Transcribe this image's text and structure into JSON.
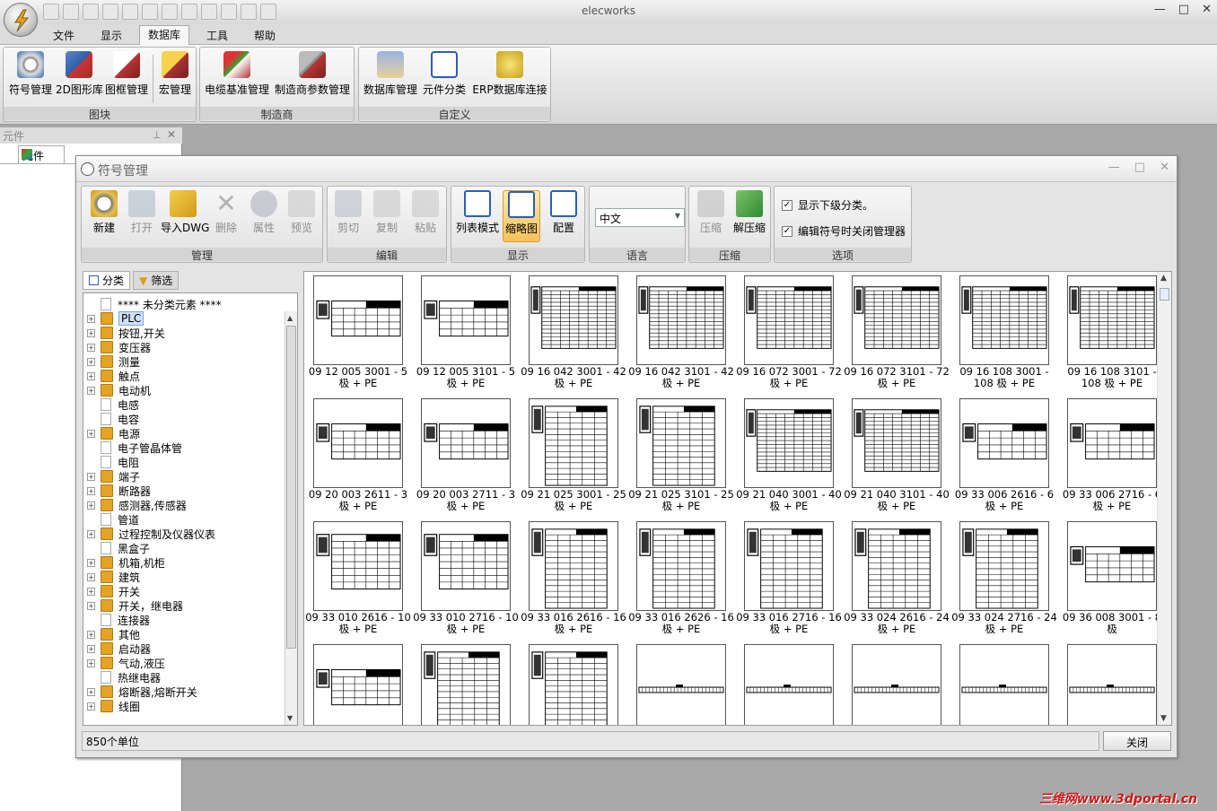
{
  "app": {
    "title": "elecworks"
  },
  "menu_tabs": [
    {
      "label": "文件"
    },
    {
      "label": "显示"
    },
    {
      "label": "数据库"
    },
    {
      "label": "工具"
    },
    {
      "label": "帮助"
    }
  ],
  "ribbon": {
    "groups": [
      {
        "label": "图块",
        "buttons": [
          "符号管理",
          "2D图形库",
          "图框管理",
          "宏管理"
        ]
      },
      {
        "label": "制造商",
        "buttons": [
          "电缆基准管理",
          "制造商参数管理"
        ]
      },
      {
        "label": "自定义",
        "buttons": [
          "数据库管理",
          "元件分类",
          "ERP数据库连接"
        ]
      }
    ]
  },
  "left_panel": {
    "header": "元件",
    "tab": "元件"
  },
  "dialog": {
    "title": "符号管理",
    "groups": {
      "manage": {
        "label": "管理",
        "buttons": [
          "新建",
          "打开",
          "导入DWG",
          "删除",
          "属性",
          "预览"
        ]
      },
      "edit": {
        "label": "编辑",
        "buttons": [
          "剪切",
          "复制",
          "粘贴"
        ]
      },
      "display": {
        "label": "显示",
        "buttons": [
          "列表模式",
          "缩略图",
          "配置"
        ]
      },
      "language": {
        "label": "语言",
        "selected": "中文"
      },
      "compress": {
        "label": "压缩",
        "buttons": [
          "压缩",
          "解压缩"
        ]
      },
      "options": {
        "label": "选项",
        "checkboxes": [
          {
            "label": "显示下级分类。",
            "checked": true
          },
          {
            "label": "编辑符号时关闭管理器",
            "checked": true
          }
        ]
      }
    },
    "tree_tabs": [
      "分类",
      "筛选"
    ],
    "tree": [
      {
        "label": "**** 未分类元素 ****",
        "expandable": false,
        "folder": false
      },
      {
        "label": "PLC",
        "expandable": true,
        "folder": true,
        "selected": true
      },
      {
        "label": "按钮,开关",
        "expandable": true,
        "folder": true
      },
      {
        "label": "变压器",
        "expandable": true,
        "folder": true
      },
      {
        "label": "测量",
        "expandable": true,
        "folder": true
      },
      {
        "label": "触点",
        "expandable": true,
        "folder": true
      },
      {
        "label": "电动机",
        "expandable": true,
        "folder": true
      },
      {
        "label": "电感",
        "expandable": false,
        "folder": false
      },
      {
        "label": "电容",
        "expandable": false,
        "folder": false
      },
      {
        "label": "电源",
        "expandable": true,
        "folder": true
      },
      {
        "label": "电子管晶体管",
        "expandable": false,
        "folder": false
      },
      {
        "label": "电阻",
        "expandable": false,
        "folder": false
      },
      {
        "label": "端子",
        "expandable": true,
        "folder": true
      },
      {
        "label": "断路器",
        "expandable": true,
        "folder": true
      },
      {
        "label": "感测器,传感器",
        "expandable": true,
        "folder": true
      },
      {
        "label": "管道",
        "expandable": false,
        "folder": false
      },
      {
        "label": "过程控制及仪器仪表",
        "expandable": true,
        "folder": true
      },
      {
        "label": "黑盒子",
        "expandable": false,
        "folder": false
      },
      {
        "label": "机箱,机柜",
        "expandable": true,
        "folder": true
      },
      {
        "label": "建筑",
        "expandable": true,
        "folder": true
      },
      {
        "label": "开关",
        "expandable": true,
        "folder": true
      },
      {
        "label": "开关，继电器",
        "expandable": true,
        "folder": true
      },
      {
        "label": "连接器",
        "expandable": false,
        "folder": false
      },
      {
        "label": "其他",
        "expandable": true,
        "folder": true
      },
      {
        "label": "启动器",
        "expandable": true,
        "folder": true
      },
      {
        "label": "气动,液压",
        "expandable": true,
        "folder": true
      },
      {
        "label": "热继电器",
        "expandable": false,
        "folder": false
      },
      {
        "label": "熔断器,熔断开关",
        "expandable": true,
        "folder": true
      },
      {
        "label": "线圈",
        "expandable": true,
        "folder": true
      }
    ],
    "thumbnails": [
      {
        "label": "09 12 005 3001 - 5 极 + PE",
        "style": "wide"
      },
      {
        "label": "09 12 005 3101 - 5 极 + PE",
        "style": "wide"
      },
      {
        "label": "09 16 042 3001 - 42 极 + PE",
        "style": "dense"
      },
      {
        "label": "09 16 042 3101 - 42 极 + PE",
        "style": "dense"
      },
      {
        "label": "09 16 072 3001 - 72 极 + PE",
        "style": "dense"
      },
      {
        "label": "09 16 072 3101 - 72 极 + PE",
        "style": "dense"
      },
      {
        "label": "09 16 108 3001 - 108 极 + PE",
        "style": "dense"
      },
      {
        "label": "09 16 108 3101 - 108 极 + PE",
        "style": "dense"
      },
      {
        "label": "09 20 003 2611 - 3 极 + PE",
        "style": "wide"
      },
      {
        "label": "09 20 003 2711 - 3 极 + PE",
        "style": "wide"
      },
      {
        "label": "09 21 025 3001 - 25 极 + PE",
        "style": "tall"
      },
      {
        "label": "09 21 025 3101 - 25 极 + PE",
        "style": "tall"
      },
      {
        "label": "09 21 040 3001 - 40 极 + PE",
        "style": "dense"
      },
      {
        "label": "09 21 040 3101 - 40 极 + PE",
        "style": "dense"
      },
      {
        "label": "09 33 006 2616 - 6 极 + PE",
        "style": "wide"
      },
      {
        "label": "09 33 006 2716 - 6 极 + PE",
        "style": "wide"
      },
      {
        "label": "09 33 010 2616 - 10 极 + PE",
        "style": "medium"
      },
      {
        "label": "09 33 010 2716 - 10 极 + PE",
        "style": "medium"
      },
      {
        "label": "09 33 016 2616 - 16 极 + PE",
        "style": "tall"
      },
      {
        "label": "09 33 016 2626 - 16 极 + PE",
        "style": "tall"
      },
      {
        "label": "09 33 016 2716 - 16 极 + PE",
        "style": "tall"
      },
      {
        "label": "09 33 024 2616 - 24 极 + PE",
        "style": "tall"
      },
      {
        "label": "09 33 024 2716 - 24 极 + PE",
        "style": "tall"
      },
      {
        "label": "09 36 008 3001 - 8 极",
        "style": "wide"
      },
      {
        "label": "",
        "style": "wide"
      },
      {
        "label": "",
        "style": "tall"
      },
      {
        "label": "",
        "style": "tall"
      },
      {
        "label": "",
        "style": "bar"
      },
      {
        "label": "",
        "style": "bar"
      },
      {
        "label": "",
        "style": "bar"
      },
      {
        "label": "",
        "style": "bar"
      },
      {
        "label": "",
        "style": "bar"
      }
    ],
    "status": "850个单位",
    "close_label": "关闭"
  },
  "watermark": "三维网www.3dportal.cn"
}
